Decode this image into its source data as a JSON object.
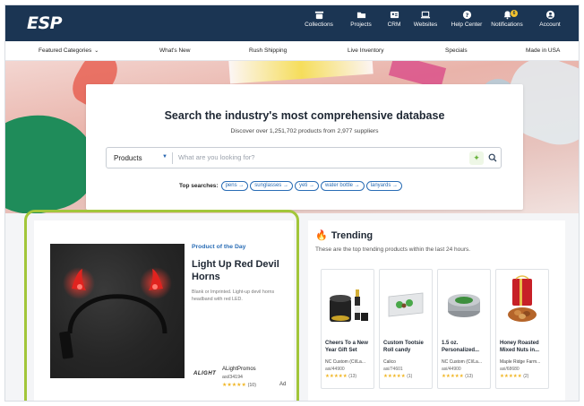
{
  "nav": {
    "logo": "ESP",
    "items": [
      {
        "label": "Collections",
        "icon": "collections-icon"
      },
      {
        "label": "Projects",
        "icon": "folder-icon"
      },
      {
        "label": "CRM",
        "icon": "contact-card-icon"
      },
      {
        "label": "Websites",
        "icon": "laptop-icon"
      },
      {
        "label": "Help Center",
        "icon": "help-icon"
      },
      {
        "label": "Notifications",
        "icon": "bell-icon",
        "badge": "6"
      },
      {
        "label": "Account",
        "icon": "account-icon"
      }
    ]
  },
  "secnav": {
    "featured": "Featured Categories",
    "whats_new": "What's New",
    "rush": "Rush Shipping",
    "live": "Live Inventory",
    "specials": "Specials",
    "usa": "Made in USA"
  },
  "search": {
    "title": "Search the industry's most comprehensive database",
    "subtitle": "Discover over 1,251,702 products from 2,977 suppliers",
    "category": "Products",
    "placeholder": "What are you looking for?",
    "top_label": "Top searches:",
    "top_terms": [
      "pens →",
      "sunglasses →",
      "yeti →",
      "water bottle →",
      "lanyards →"
    ]
  },
  "potd": {
    "tag": "Product of the Day",
    "title": "Light Up Red Devil Horns",
    "description": "Blank or Imprinted. Light-up devil horns headband with red LED.",
    "logo_text": "ALIGHT",
    "supplier": "ALightPromos",
    "asi": "asi/34194",
    "stars": "★★★★★",
    "review_count": "(10)",
    "rating": 5,
    "ad_label": "Ad"
  },
  "trending": {
    "title": "Trending",
    "subtitle": "These are the top trending products within the last 24 hours.",
    "products": [
      {
        "name": "Cheers To a New Year Gift Set",
        "supplier": "NC Custom (CI/La...",
        "asi": "asi/44900",
        "stars": "★★★★★",
        "reviews": "(13)"
      },
      {
        "name": "Custom Tootsie Roll candy",
        "supplier": "Calico",
        "asi": "asi/74601",
        "stars": "★★★★★",
        "reviews": "(1)"
      },
      {
        "name": "1.5 oz. Personalized...",
        "supplier": "NC Custom (CI/La...",
        "asi": "asi/44900",
        "stars": "★★★★★",
        "reviews": "(13)"
      },
      {
        "name": "Honey Roasted Mixed Nuts in...",
        "supplier": "Maple Ridge Farm...",
        "asi": "asi/68680",
        "stars": "★★★★★",
        "reviews": "(2)"
      }
    ]
  },
  "colors": {
    "nav_bg": "#1b3553",
    "accent_blue": "#2a6db5",
    "highlight_green": "#a2c63a",
    "star": "#f1b728"
  }
}
